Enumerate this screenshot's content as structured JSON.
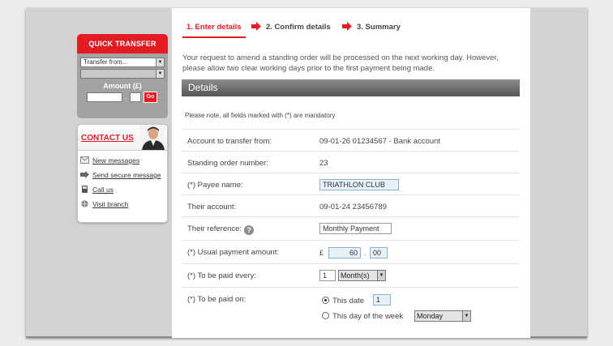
{
  "quick_transfer": {
    "title": "QUICK TRANSFER",
    "from_select": "Transfer from...",
    "to_select": "",
    "amount_label": "Amount (£)",
    "separator": ".",
    "go_label": "Go"
  },
  "contact": {
    "title": "CONTACT US",
    "items": [
      {
        "label": "New messages",
        "icon": "envelope-icon"
      },
      {
        "label": "Send secure message",
        "icon": "send-arrow-icon"
      },
      {
        "label": "Call us",
        "icon": "phone-icon"
      },
      {
        "label": "Visit branch",
        "icon": "globe-icon"
      }
    ]
  },
  "steps": [
    {
      "label": "1. Enter details",
      "active": true
    },
    {
      "label": "2. Confirm details",
      "active": false
    },
    {
      "label": "3. Summary",
      "active": false
    }
  ],
  "intro_text": "Your request to amend a standing order will be processed on the next working day. However, please allow two clear working days prior to the first payment being made.",
  "details_title": "Details",
  "mandatory_note": "Please note, all fields marked with (*) are mandatory",
  "form": {
    "account_from": {
      "label": "Account to transfer from:",
      "value": "09-01-26 01234567 - Bank account"
    },
    "standing_order": {
      "label": "Standing order number:",
      "value": "23"
    },
    "payee_name": {
      "label": "(*) Payee name:",
      "value": "TRIATHLON CLUB"
    },
    "their_account": {
      "label": "Their account:",
      "value": "09-01-24 23456789"
    },
    "their_reference": {
      "label": "Their reference:",
      "value": "Monthly Payment"
    },
    "usual_amount": {
      "label": "(*) Usual payment amount:",
      "currency": "£",
      "pounds": "60",
      "separator": ".",
      "pence": "00"
    },
    "paid_every": {
      "label": "(*) To be paid every:",
      "count": "1",
      "period": "Month(s)"
    },
    "paid_on": {
      "label": "(*) To be paid on:",
      "option_date": "This date",
      "date_value": "1",
      "option_day": "This day of the week",
      "day_value": "Monday",
      "selected": "date"
    }
  },
  "colors": {
    "accent": "#e31b23",
    "header_bar": "#6e6e6e",
    "field_border": "#8ab0d6"
  }
}
